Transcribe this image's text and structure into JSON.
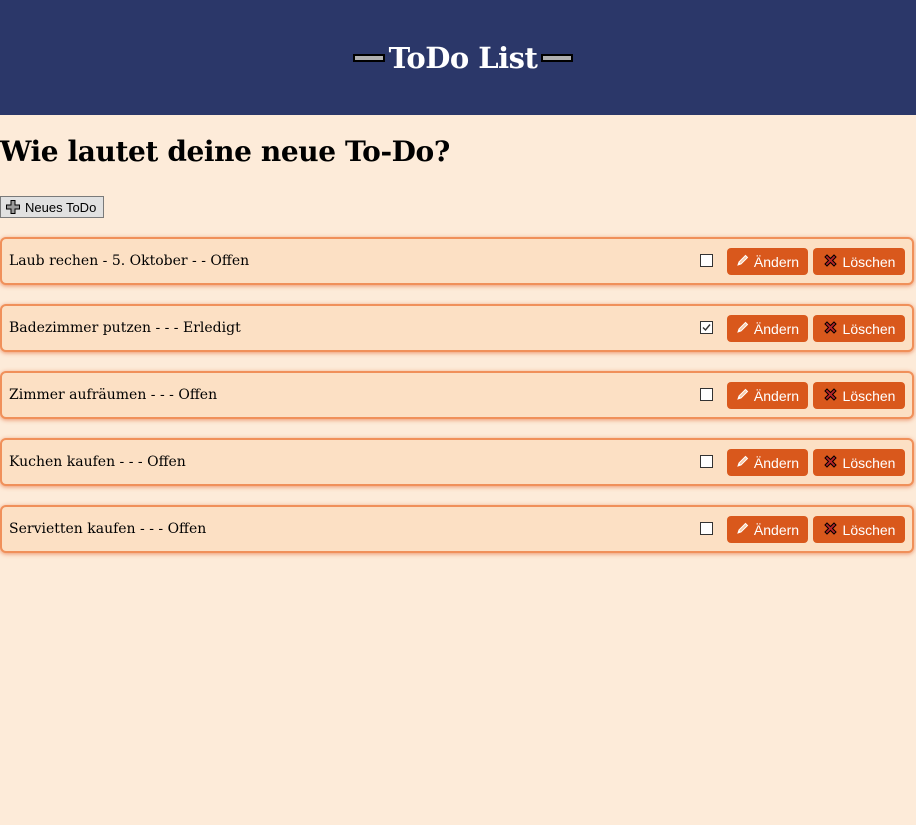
{
  "header": {
    "title": "ToDo List"
  },
  "question": "Wie lautet deine neue To-Do?",
  "new_todo_button": {
    "label": "Neues ToDo",
    "icon": "plus-icon"
  },
  "todos": [
    {
      "text": "Laub rechen - 5. Oktober - - Offen",
      "done": false
    },
    {
      "text": "Badezimmer putzen - - - Erledigt",
      "done": true
    },
    {
      "text": "Zimmer aufräumen - - - Offen",
      "done": false
    },
    {
      "text": "Kuchen kaufen - - - Offen",
      "done": false
    },
    {
      "text": "Servietten kaufen - - - Offen",
      "done": false
    }
  ],
  "actions": {
    "edit_label": "Ändern",
    "edit_icon": "pencil-icon",
    "delete_label": "Löschen",
    "delete_icon": "x-icon"
  },
  "colors": {
    "header_bg": "#2b3769",
    "page_bg": "#fdebd9",
    "item_bg": "#fce0c4",
    "item_border": "#f0905a",
    "button_bg": "#d9581c"
  }
}
